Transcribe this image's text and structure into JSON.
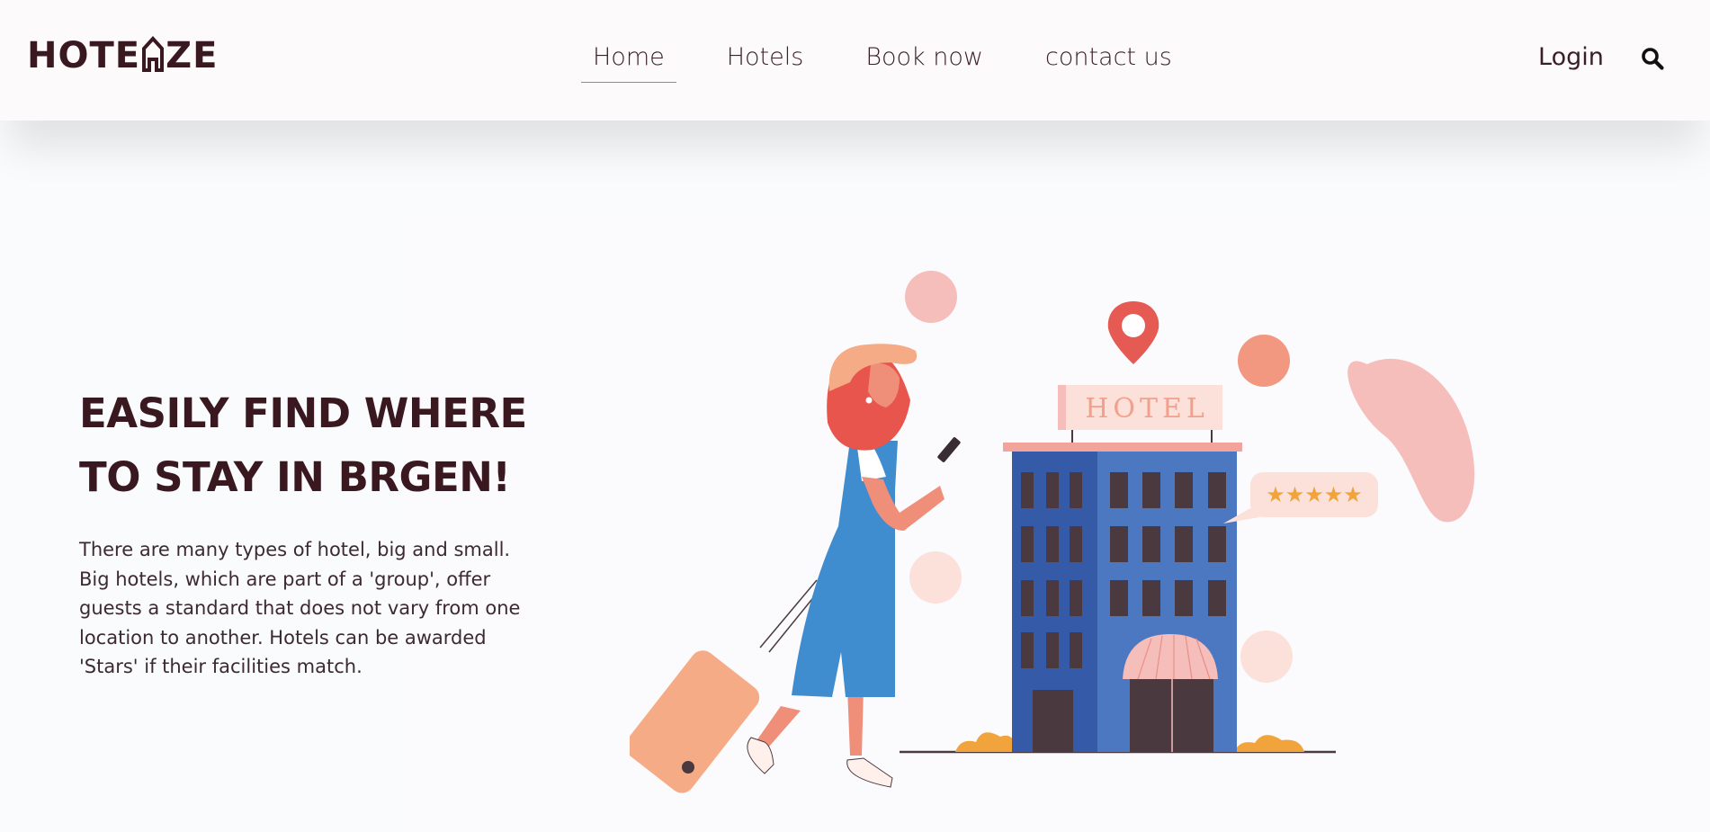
{
  "brand": {
    "logo_text_left": "HOTE",
    "logo_text_right": "ZE"
  },
  "nav": {
    "links": [
      {
        "label": "Home",
        "active": true
      },
      {
        "label": "Hotels",
        "active": false
      },
      {
        "label": "Book now",
        "active": false
      },
      {
        "label": "contact us",
        "active": false
      }
    ],
    "login_label": "Login",
    "search_icon": "search-icon"
  },
  "hero": {
    "title_line1": "EASILY FIND WHERE",
    "title_line2": "TO STAY IN BRGEN!",
    "description": "There are many types of hotel, big and small. Big hotels, which are part of a 'group', offer guests a standard that does not vary from one location to another. Hotels can be awarded 'Stars' if their facilities match."
  },
  "illustration": {
    "hotel_sign": "HOTEL",
    "rating_stars": "★★★★★"
  },
  "colors": {
    "accent": "#e06a68",
    "text_dark": "#3a1820",
    "navbar_bg": "#fdfafb",
    "building_blue": "#4b78c0",
    "star_orange": "#f2a43c"
  }
}
